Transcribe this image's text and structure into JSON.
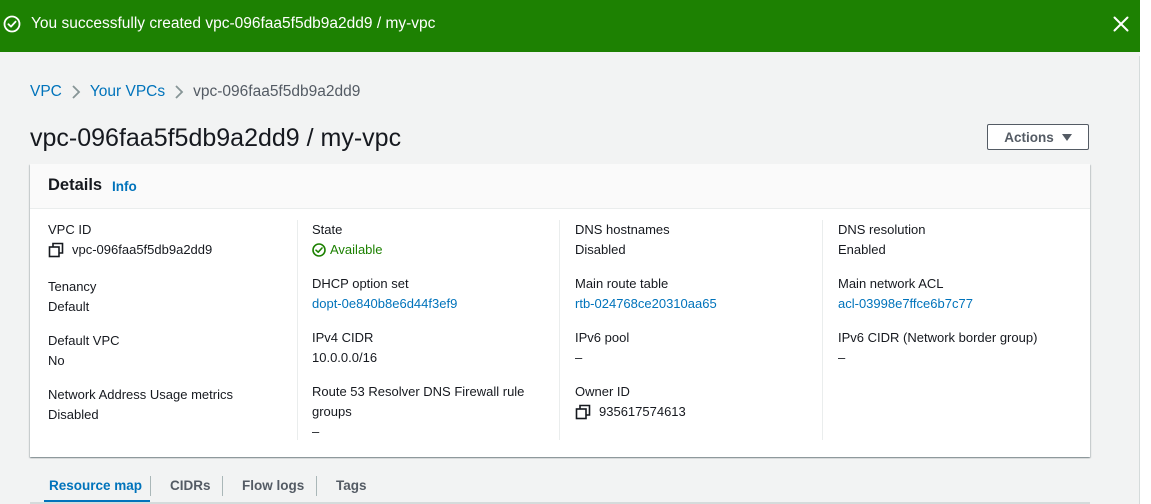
{
  "flash": {
    "message": "You successfully created vpc-096faa5f5db9a2dd9 / my-vpc",
    "status_icon": "success-circle-icon",
    "close_icon": "close-icon",
    "color": "#1d8102"
  },
  "breadcrumb": {
    "items": [
      "VPC",
      "Your VPCs"
    ],
    "current": "vpc-096faa5f5db9a2dd9"
  },
  "page": {
    "title": "vpc-096faa5f5db9a2dd9 / my-vpc",
    "actions_label": "Actions"
  },
  "details": {
    "title": "Details",
    "info_label": "Info",
    "columns": [
      [
        {
          "label": "VPC ID",
          "value": "vpc-096faa5f5db9a2dd9",
          "copy": true
        },
        {
          "label": "Tenancy",
          "value": "Default"
        },
        {
          "label": "Default VPC",
          "value": "No"
        },
        {
          "label": "Network Address Usage metrics",
          "value": "Disabled"
        }
      ],
      [
        {
          "label": "State",
          "value": "Available",
          "status": "ok"
        },
        {
          "label": "DHCP option set",
          "value": "dopt-0e840b8e6d44f3ef9",
          "link": true
        },
        {
          "label": "IPv4 CIDR",
          "value": "10.0.0.0/16"
        },
        {
          "label_line1": "Route 53 Resolver DNS Firewall rule",
          "label_line2": "groups",
          "value": "–"
        }
      ],
      [
        {
          "label": "DNS hostnames",
          "value": "Disabled"
        },
        {
          "label": "Main route table",
          "value": "rtb-024768ce20310aa65",
          "link": true
        },
        {
          "label": "IPv6 pool",
          "value": "–"
        },
        {
          "label": "Owner ID",
          "value": "935617574613",
          "copy": true
        }
      ],
      [
        {
          "label": "DNS resolution",
          "value": "Enabled"
        },
        {
          "label": "Main network ACL",
          "value": "acl-03998e7ffce6b7c77",
          "link": true
        },
        {
          "label": "IPv6 CIDR (Network border group)",
          "value": "–"
        }
      ]
    ]
  },
  "tabs": [
    "Resource map",
    "CIDRs",
    "Flow logs",
    "Tags"
  ],
  "colors": {
    "link": "#0073bb",
    "success": "#1d8102",
    "background": "#f2f3f3"
  }
}
